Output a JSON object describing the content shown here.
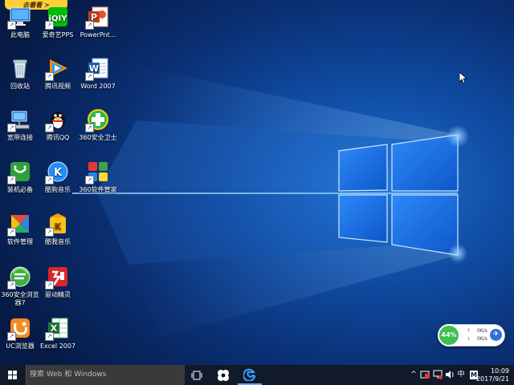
{
  "ad_banner": {
    "label": "去看看 >"
  },
  "desktop_icons": [
    {
      "label": "此电脑"
    },
    {
      "label": "爱奇艺PPS"
    },
    {
      "label": "PowerPnt..."
    },
    {
      "label": "回收站"
    },
    {
      "label": "腾讯视频"
    },
    {
      "label": "Word 2007"
    },
    {
      "label": "宽带连接"
    },
    {
      "label": "腾讯QQ"
    },
    {
      "label": "360安全卫士"
    },
    {
      "label": "装机必备"
    },
    {
      "label": "酷狗音乐"
    },
    {
      "label": "360软件管家"
    },
    {
      "label": "软件管理"
    },
    {
      "label": "酷我音乐"
    },
    {
      "label": "360安全浏览\n器7"
    },
    {
      "label": "驱动精灵"
    },
    {
      "label": "UC浏览器"
    },
    {
      "label": "Excel 2007"
    }
  ],
  "net_widget": {
    "percent": "44%",
    "upload_rate": "0K/s",
    "download_rate": "0K/s"
  },
  "taskbar": {
    "search_placeholder": "搜索 Web 和 Windows",
    "ime_label": "中",
    "ime_mode": "M",
    "clock_time": "10:09",
    "clock_date": "2017/9/21"
  },
  "colors": {
    "taskbar_bg": "#101a2a",
    "search_bg": "#3a3a3a",
    "net_green": "#3fbf4f"
  }
}
